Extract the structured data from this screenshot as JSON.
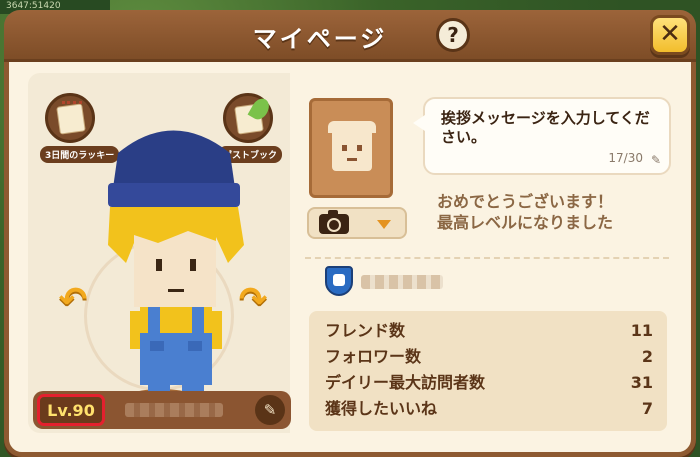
{
  "header": {
    "title": "マイページ",
    "help_label": "?",
    "close_label": "✕"
  },
  "background": {
    "top_left_text": "3647:51420"
  },
  "left_panel": {
    "badges": [
      {
        "label": "3日間のラッキー",
        "icon": "calendar-icon"
      },
      {
        "label": "ゲストブック",
        "icon": "guestbook-icon"
      }
    ],
    "arrow_left": "↶",
    "arrow_right": "↷",
    "level": "Lv.90",
    "edit_icon": "✎"
  },
  "right_panel": {
    "message": "挨拶メッセージを入力してください。",
    "message_count": "17/30",
    "pen_icon": "✎",
    "congrats_line1": "おめでとうございます！",
    "congrats_line2": "最高レベルになりました",
    "stats": [
      {
        "label": "フレンド数",
        "value": "11"
      },
      {
        "label": "フォロワー数",
        "value": "2"
      },
      {
        "label": "デイリー最大訪問者数",
        "value": "31"
      },
      {
        "label": "獲得したいいね",
        "value": "7"
      }
    ]
  },
  "colors": {
    "frame": "#8e5a31",
    "panel": "#fbf3e2",
    "accent_yellow": "#f2bd2c",
    "level_highlight": "#e4202e"
  }
}
